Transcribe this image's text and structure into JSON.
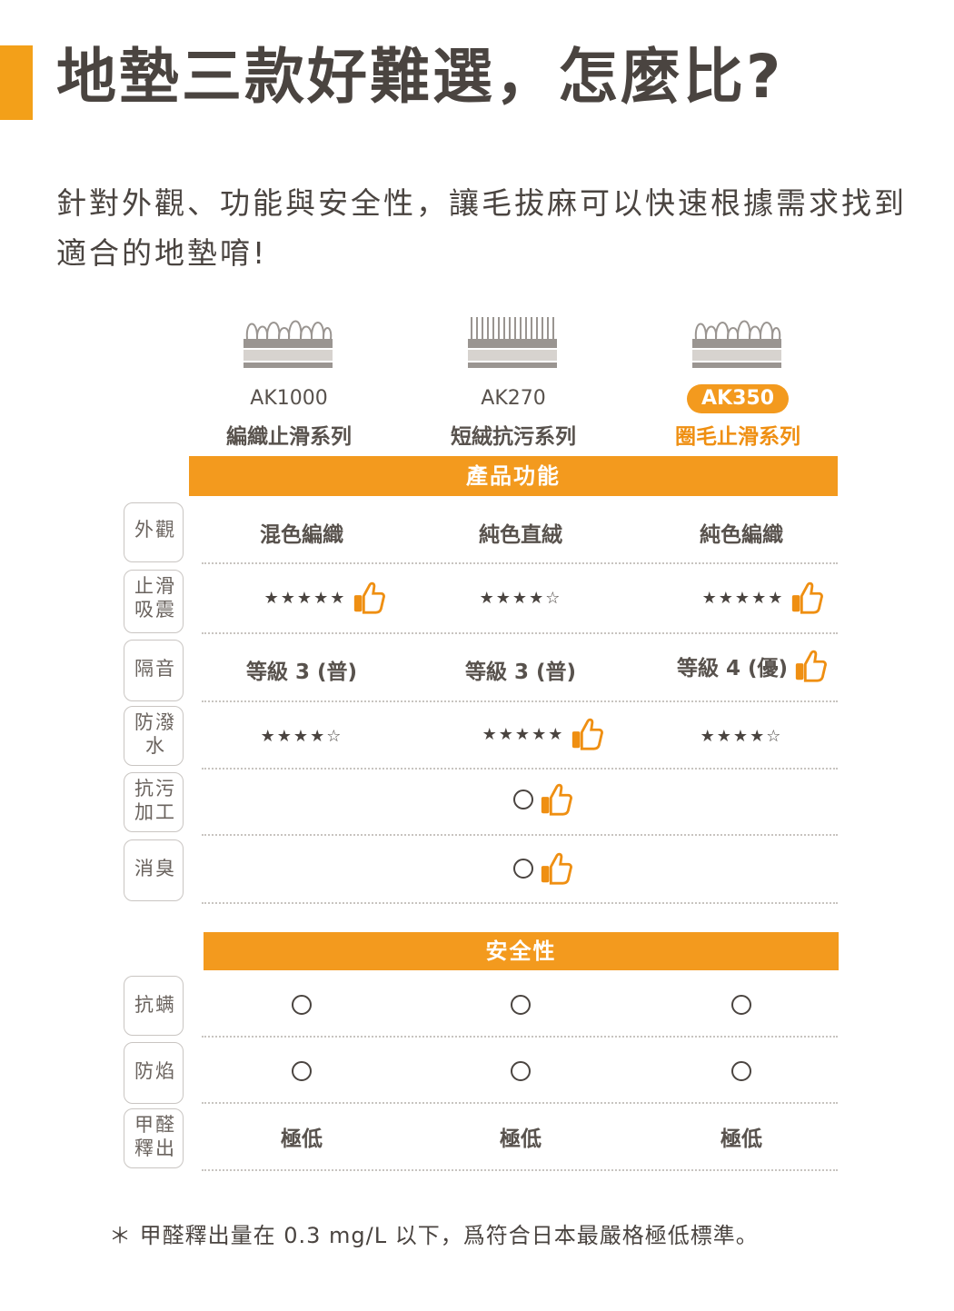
{
  "title": "地墊三款好難選，怎麼比?",
  "intro": "針對外觀、功能與安全性，讓毛拔麻可以快速根據需求找到適合的地墊唷!",
  "products": [
    {
      "model": "AK1000",
      "series": "編織止滑系列"
    },
    {
      "model": "AK270",
      "series": "短絨抗污系列"
    },
    {
      "model": "AK350",
      "series": "圈毛止滑系列"
    }
  ],
  "sections": {
    "function": "產品功能",
    "safety": "安全性"
  },
  "rows": {
    "appearance": {
      "label": [
        "外觀"
      ],
      "values": [
        "混色編織",
        "純色直絨",
        "純色編織"
      ]
    },
    "antislip": {
      "label": [
        "止滑",
        "吸震"
      ],
      "values": [
        "★★★★★",
        "★★★★☆",
        "★★★★★"
      ]
    },
    "sound": {
      "label": [
        "隔音"
      ],
      "values": [
        "等級 3 (普)",
        "等級 3 (普)",
        "等級 4 (優)"
      ]
    },
    "waterproof": {
      "label": [
        "防潑",
        "水"
      ],
      "values": [
        "★★★★☆",
        "★★★★★",
        "★★★★☆"
      ]
    },
    "antistain": {
      "label": [
        "抗污",
        "加工"
      ],
      "values": [
        "",
        "○",
        ""
      ]
    },
    "deodor": {
      "label": [
        "消臭"
      ],
      "values": [
        "",
        "○",
        ""
      ]
    },
    "antimite": {
      "label": [
        "抗螨"
      ],
      "values": [
        "○",
        "○",
        "○"
      ]
    },
    "flame": {
      "label": [
        "防焰"
      ],
      "values": [
        "○",
        "○",
        "○"
      ]
    },
    "formaldehyde": {
      "label": [
        "甲醛",
        "釋出"
      ],
      "values": [
        "極低",
        "極低",
        "極低"
      ]
    }
  },
  "footnote": "＊ 甲醛釋出量在 0.3 mg/L 以下，爲符合日本最嚴格極低標準。",
  "colors": {
    "accent": "#f39a1e",
    "text": "#4a4440"
  },
  "icons": {
    "recommend": "thumbs-up-icon"
  }
}
